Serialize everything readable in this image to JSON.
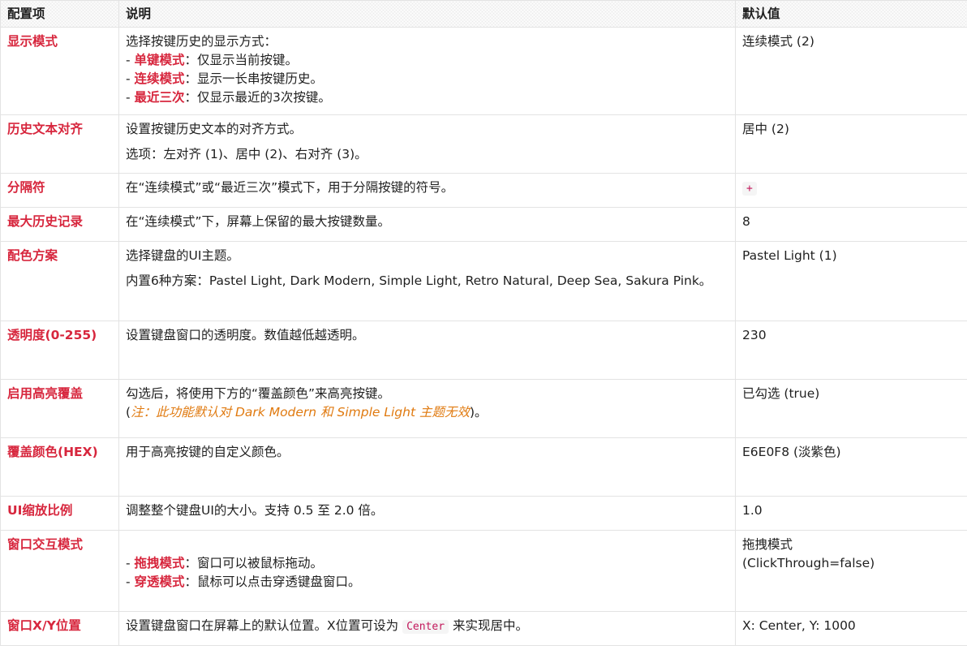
{
  "headers": {
    "key": "配置项",
    "desc": "说明",
    "default": "默认值"
  },
  "rows": [
    {
      "key": "显示模式",
      "intro": "选择按键历史的显示方式：",
      "items": [
        {
          "prefix": "- ",
          "term": "单键模式",
          "text": "：仅显示当前按键。"
        },
        {
          "prefix": "- ",
          "term": "连续模式",
          "text": "：显示一长串按键历史。"
        },
        {
          "prefix": "- ",
          "term": "最近三次",
          "text": "：仅显示最近的3次按键。"
        }
      ],
      "default": "连续模式 (2)"
    },
    {
      "key": "历史文本对齐",
      "line1": "设置按键历史文本的对齐方式。",
      "line2": "选项：左对齐 (1)、居中 (2)、右对齐 (3)。",
      "default": "居中 (2)"
    },
    {
      "key": "分隔符",
      "desc": "在“连续模式”或“最近三次”模式下，用于分隔按键的符号。",
      "default": "+"
    },
    {
      "key": "最大历史记录",
      "desc": "在“连续模式”下，屏幕上保留的最大按键数量。",
      "default": "8"
    },
    {
      "key": "配色方案",
      "line1": "选择键盘的UI主题。",
      "line2": "内置6种方案：Pastel Light, Dark Modern, Simple Light, Retro Natural, Deep Sea, Sakura Pink。",
      "default": "Pastel Light (1)"
    },
    {
      "key": "透明度(0-255)",
      "desc": "设置键盘窗口的透明度。数值越低越透明。",
      "default": "230"
    },
    {
      "key": "启用高亮覆盖",
      "line1": "勾选后，将使用下方的“覆盖颜色”来高亮按键。",
      "note_open": "(",
      "note": "注：此功能默认对 Dark Modern 和 Simple Light 主题无效",
      "note_close": ")。",
      "default": "已勾选 (true)"
    },
    {
      "key": "覆盖颜色(HEX)",
      "desc": "用于高亮按键的自定义颜色。",
      "default": "E6E0F8 (淡紫色)"
    },
    {
      "key": "UI缩放比例",
      "desc": "调整整个键盘UI的大小。支持 0.5 至 2.0 倍。",
      "default": "1.0"
    },
    {
      "key": "窗口交互模式",
      "items": [
        {
          "prefix": "- ",
          "term": "拖拽模式",
          "text": "：窗口可以被鼠标拖动。"
        },
        {
          "prefix": "- ",
          "term": "穿透模式",
          "text": "：鼠标可以点击穿透键盘窗口。"
        }
      ],
      "default": "拖拽模式 (ClickThrough=false)"
    },
    {
      "key": "窗口X/Y位置",
      "desc_before": "设置键盘窗口在屏幕上的默认位置。X位置可设为 ",
      "code": "Center",
      "desc_after": " 来实现居中。",
      "default": "X: Center, Y: 1000"
    }
  ],
  "colors": {
    "key_red": "#d7263d",
    "note_orange": "#e07a10",
    "code_pink": "#c2185b",
    "border": "#e3e3e3"
  }
}
